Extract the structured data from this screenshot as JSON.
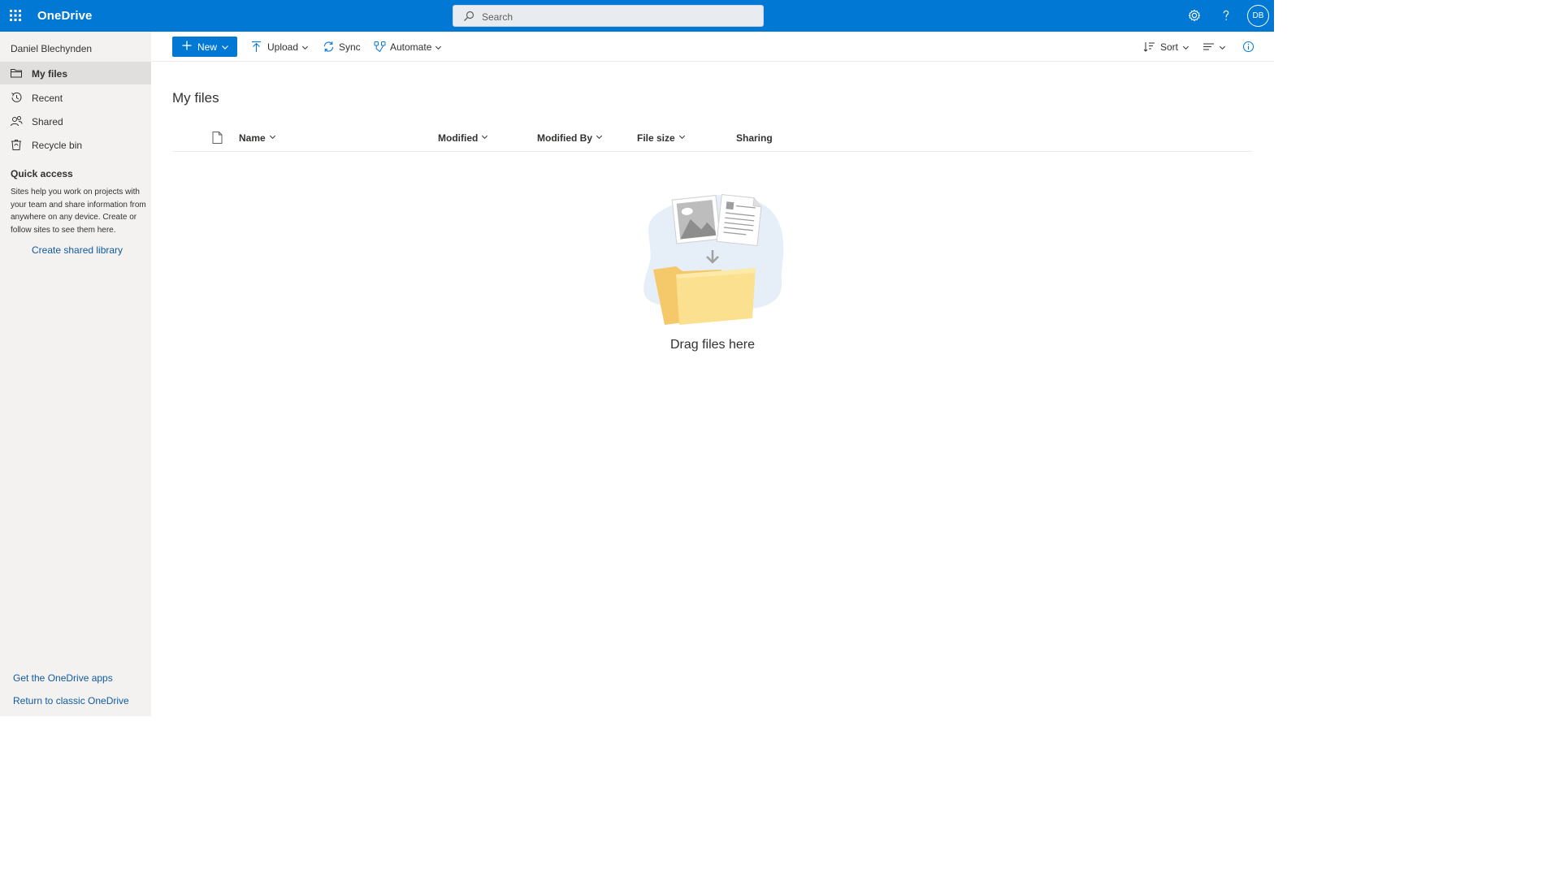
{
  "app": {
    "title": "OneDrive",
    "accent_color": "#0078d4"
  },
  "topbar": {
    "waffle_icon": "app-launcher-icon",
    "search_placeholder": "Search",
    "settings_icon": "gear-icon",
    "help_icon": "help-icon",
    "avatar_initials": "DB"
  },
  "sidebar": {
    "user_name": "Daniel Blechynden",
    "items": [
      {
        "label": "My files",
        "icon": "folder-icon",
        "active": true
      },
      {
        "label": "Recent",
        "icon": "history-icon",
        "active": false
      },
      {
        "label": "Shared",
        "icon": "people-icon",
        "active": false
      },
      {
        "label": "Recycle bin",
        "icon": "recycle-bin-icon",
        "active": false
      }
    ],
    "quick_access": {
      "title": "Quick access",
      "description": "Sites help you work on projects with your team and share information from anywhere on any device. Create or follow sites to see them here.",
      "create_link": "Create shared library"
    },
    "footer_links": {
      "get_apps": "Get the OneDrive apps",
      "classic": "Return to classic OneDrive"
    }
  },
  "commandbar": {
    "new_label": "New",
    "upload_label": "Upload",
    "sync_label": "Sync",
    "automate_label": "Automate",
    "sort_label": "Sort"
  },
  "main": {
    "title": "My files",
    "columns": [
      "Name",
      "Modified",
      "Modified By",
      "File size",
      "Sharing"
    ],
    "empty_state_text": "Drag files here"
  }
}
